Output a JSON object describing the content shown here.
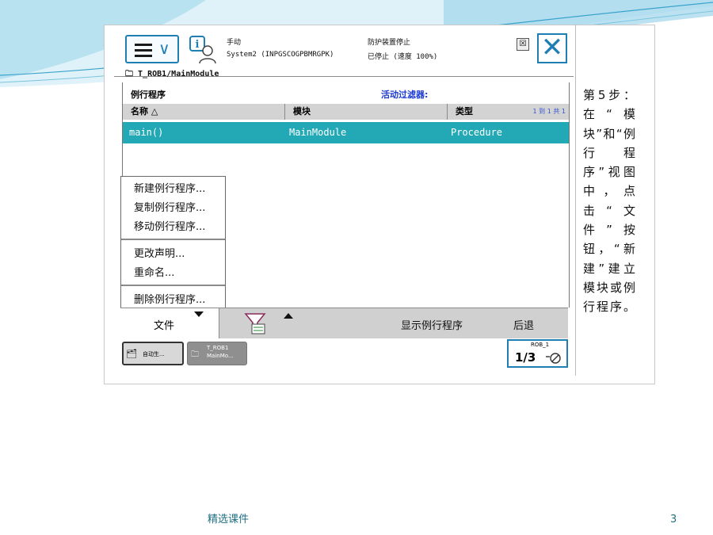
{
  "colors": {
    "accent": "#1f7fb3",
    "selection": "#23a8b5",
    "filter": "#1c3bd1",
    "footer": "#1f6f82"
  },
  "status": {
    "mode": "手动",
    "system": "System2 (INPGSCOGPBMRGPK)",
    "safety": "防护装置停止",
    "state": "已停止 (速度 100%)"
  },
  "breadcrumb": "T_ROB1/MainModule",
  "panel": {
    "title": "例行程序",
    "filter_label": "活动过滤器:",
    "columns": [
      "名称 △",
      "模块",
      "类型"
    ],
    "paging": "1 到 1 共 1",
    "rows": [
      {
        "name": "main()",
        "module": "MainModule",
        "type": "Procedure"
      }
    ]
  },
  "popup_menu": [
    "新建例行程序...",
    "复制例行程序...",
    "移动例行程序...",
    "更改声明...",
    "重命名...",
    "删除例行程序..."
  ],
  "bottombar": {
    "file": "文件",
    "show_routine": "显示例行程序",
    "back": "后退"
  },
  "taskbar": {
    "task1": "自动生...",
    "task2_line1": "T_ROB1",
    "task2_line2": "MainMo...",
    "rob_label": "ROB_1",
    "fraction": "1/3"
  },
  "sidebar_text": "第5步：在“模块”和“例行程序”视图中，点击“文件”按钮，“新建”建立模块或例行程序。",
  "footer": {
    "text": "精选课件",
    "page": "3"
  }
}
